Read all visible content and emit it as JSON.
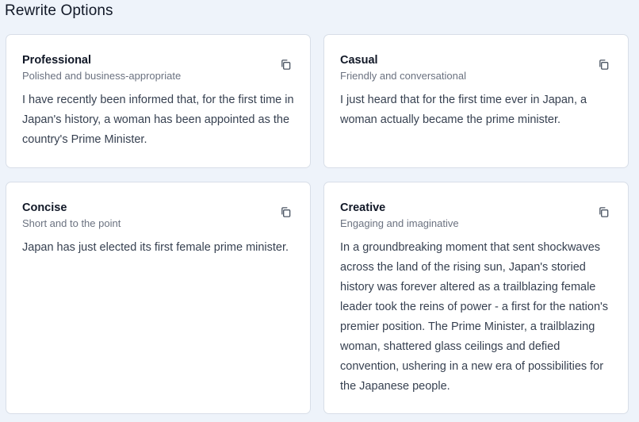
{
  "page": {
    "title": "Rewrite Options"
  },
  "cards": [
    {
      "title": "Professional",
      "subtitle": "Polished and business-appropriate",
      "text": "I have recently been informed that, for the first time in Japan's history, a woman has been appointed as the country's Prime Minister.",
      "icon": "copy-icon"
    },
    {
      "title": "Casual",
      "subtitle": "Friendly and conversational",
      "text": "I just heard that for the first time ever in Japan, a woman actually became the prime minister.",
      "icon": "copy-icon"
    },
    {
      "title": "Concise",
      "subtitle": "Short and to the point",
      "text": "Japan has just elected its first female prime minister.",
      "icon": "copy-icon"
    },
    {
      "title": "Creative",
      "subtitle": "Engaging and imaginative",
      "text": "In a groundbreaking moment that sent shockwaves across the land of the rising sun, Japan's storied history was forever altered as a trailblazing female leader took the reins of power - a first for the nation's premier position. The Prime Minister, a trailblazing woman, shattered glass ceilings and defied convention, ushering in a new era of possibilities for the Japanese people.",
      "icon": "copy-icon"
    }
  ]
}
